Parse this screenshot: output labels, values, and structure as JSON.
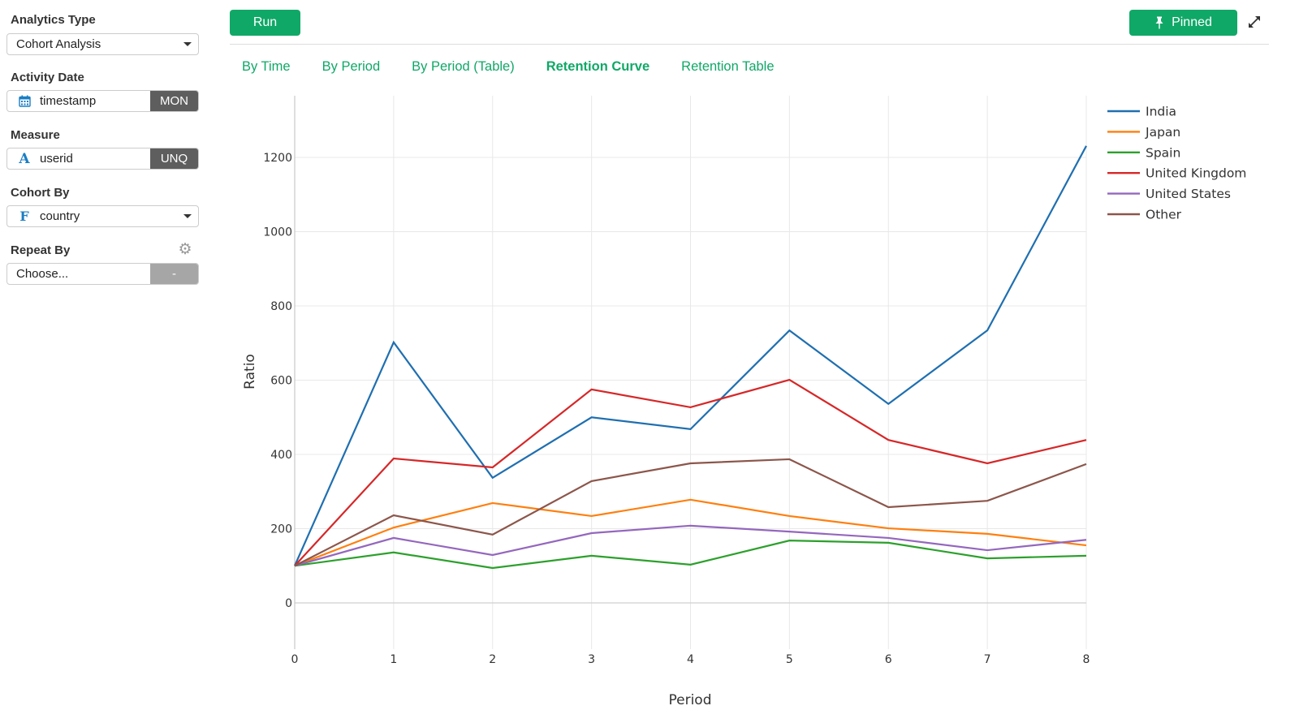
{
  "sidebar": {
    "analytics_type": {
      "label": "Analytics Type",
      "value": "Cohort Analysis"
    },
    "activity_date": {
      "label": "Activity Date",
      "value": "timestamp",
      "icon": "calendar-icon",
      "tag": "MON"
    },
    "measure": {
      "label": "Measure",
      "value": "userid",
      "type_glyph": "A",
      "tag": "UNQ"
    },
    "cohort_by": {
      "label": "Cohort By",
      "value": "country",
      "type_glyph": "F"
    },
    "repeat_by": {
      "label": "Repeat By",
      "placeholder": "Choose...",
      "tag": "-",
      "icon": "gear-icon"
    }
  },
  "toolbar": {
    "run_label": "Run",
    "pinned_label": "Pinned",
    "pin_icon": "pin-icon",
    "expand_icon": "expand-icon"
  },
  "tabs": [
    {
      "label": "By Time",
      "active": false
    },
    {
      "label": "By Period",
      "active": false
    },
    {
      "label": "By Period (Table)",
      "active": false
    },
    {
      "label": "Retention Curve",
      "active": true
    },
    {
      "label": "Retention Table",
      "active": false
    }
  ],
  "colors": {
    "accent": "#10a867"
  },
  "chart_data": {
    "type": "line",
    "title": "",
    "xlabel": "Period",
    "ylabel": "Ratio",
    "x": [
      0,
      1,
      2,
      3,
      4,
      5,
      6,
      7,
      8
    ],
    "xlim": [
      0,
      8
    ],
    "ylim": [
      -120,
      1380
    ],
    "yticks": [
      0,
      200,
      400,
      600,
      800,
      1000,
      1200
    ],
    "xticks": [
      0,
      1,
      2,
      3,
      4,
      5,
      6,
      7,
      8
    ],
    "grid": true,
    "legend_position": "top-right",
    "series": [
      {
        "name": "India",
        "color": "#1f6fb0",
        "values": [
          100,
          702,
          337,
          500,
          468,
          734,
          536,
          734,
          1231
        ]
      },
      {
        "name": "Japan",
        "color": "#ff7f0e",
        "values": [
          100,
          203,
          269,
          234,
          278,
          234,
          201,
          186,
          155
        ]
      },
      {
        "name": "Spain",
        "color": "#2ca02c",
        "values": [
          100,
          136,
          94,
          127,
          103,
          168,
          162,
          120,
          127
        ]
      },
      {
        "name": "United Kingdom",
        "color": "#d62728",
        "values": [
          100,
          389,
          365,
          575,
          527,
          601,
          439,
          376,
          439
        ]
      },
      {
        "name": "United States",
        "color": "#9467bd",
        "values": [
          100,
          175,
          129,
          188,
          208,
          192,
          175,
          142,
          170
        ]
      },
      {
        "name": "Other",
        "color": "#8c564b",
        "values": [
          100,
          236,
          184,
          328,
          376,
          387,
          258,
          275,
          374
        ]
      }
    ]
  }
}
